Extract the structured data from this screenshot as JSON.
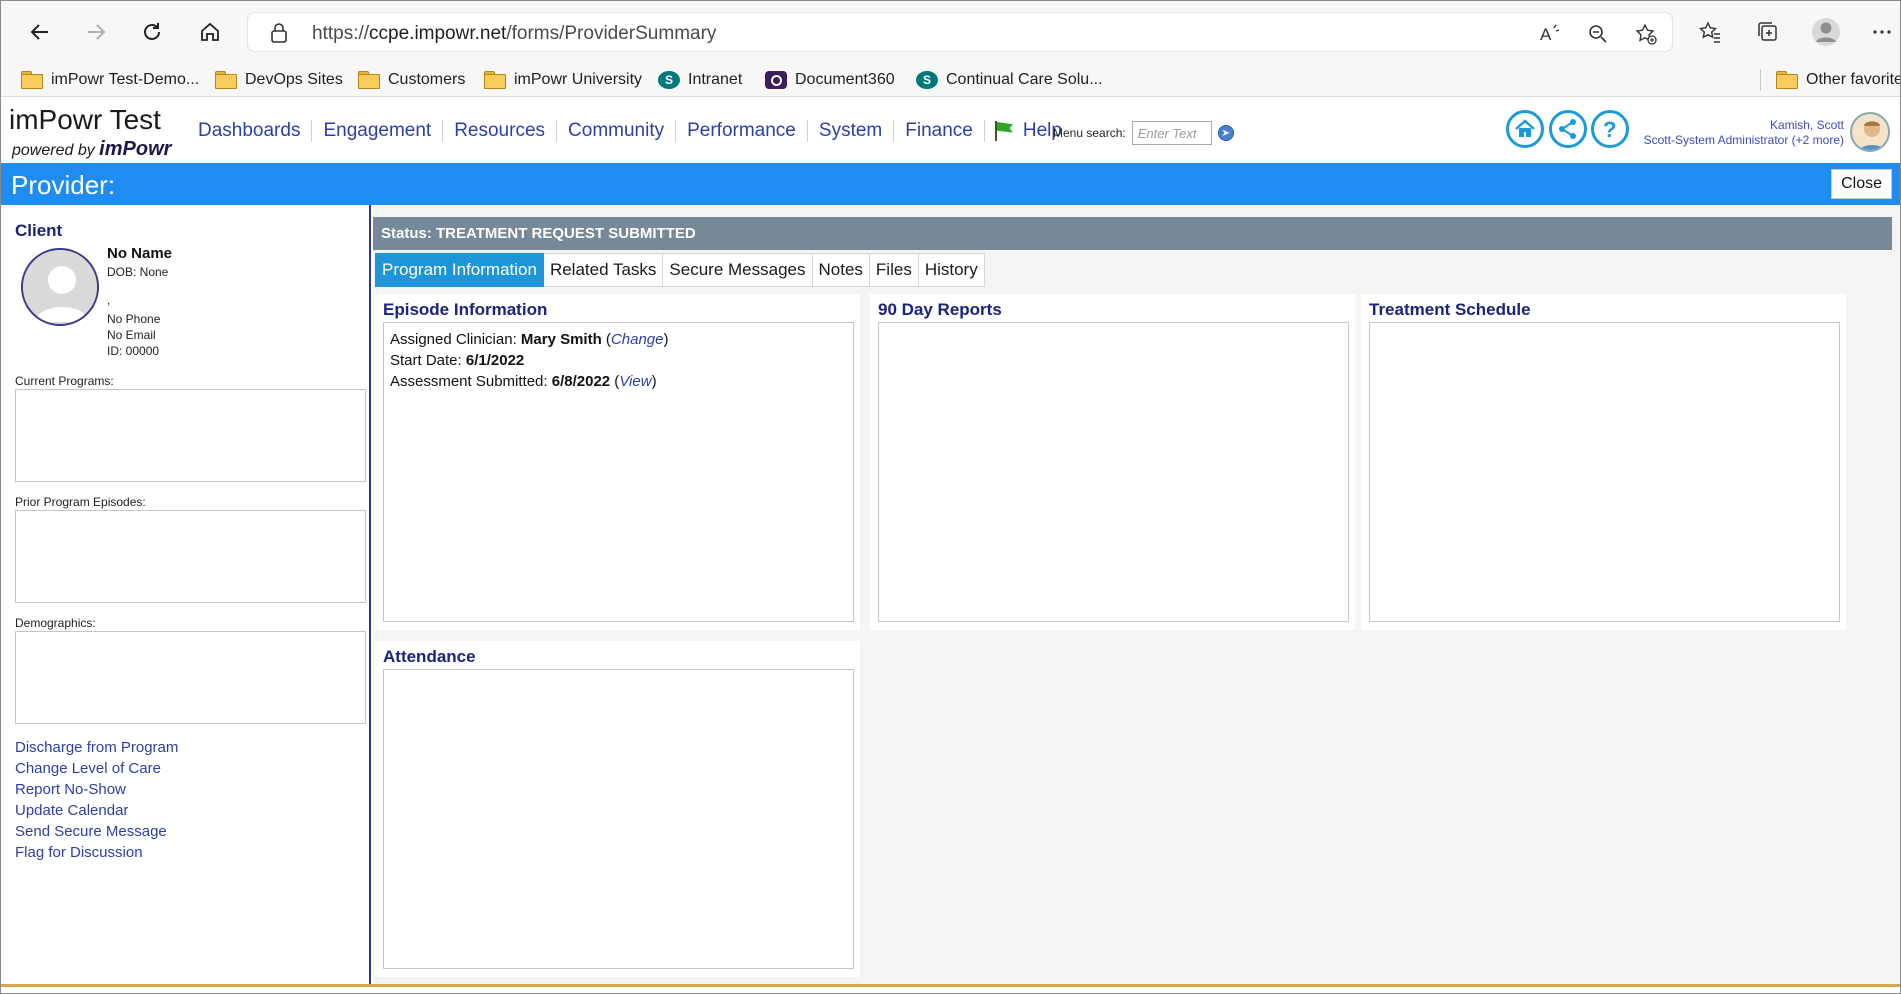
{
  "browser": {
    "url_prefix": "https://",
    "url_host": "ccpe.impowr.net",
    "url_path": "/forms/ProviderSummary",
    "bookmarks": [
      {
        "label": "imPowr Test-Demo...",
        "icon": "folder-icon"
      },
      {
        "label": "DevOps Sites",
        "icon": "folder-icon"
      },
      {
        "label": "Customers",
        "icon": "folder-icon"
      },
      {
        "label": "imPowr University",
        "icon": "folder-icon"
      },
      {
        "label": "Intranet",
        "icon": "sharepoint-icon"
      },
      {
        "label": "Document360",
        "icon": "document360-icon"
      },
      {
        "label": "Continual Care Solu...",
        "icon": "sharepoint-icon"
      }
    ],
    "other_favorites": "Other favorites"
  },
  "header": {
    "brand_title": "imPowr Test",
    "brand_sub_prefix": "powered by",
    "brand_sub_name": "imPowr",
    "nav": [
      "Dashboards",
      "Engagement",
      "Resources",
      "Community",
      "Performance",
      "System",
      "Finance"
    ],
    "help": "Help",
    "menu_search_label": "Menu search:",
    "menu_search_placeholder": "Enter Text",
    "user_name": "Kamish, Scott",
    "user_role": "Scott-System Administrator (+2 more)"
  },
  "provider_bar": {
    "title": "Provider:",
    "close_label": "Close"
  },
  "client": {
    "heading": "Client",
    "name": "No Name",
    "dob": "DOB: None",
    "comma": ",",
    "phone": "No Phone",
    "email": "No Email",
    "id": "ID: 00000",
    "current_programs_label": "Current Programs:",
    "prior_episodes_label": "Prior Program Episodes:",
    "demographics_label": "Demographics:",
    "actions": [
      "Discharge from Program",
      "Change Level of Care",
      "Report No-Show",
      "Update Calendar",
      "Send Secure Message",
      "Flag for Discussion"
    ]
  },
  "status": {
    "text": "Status: TREATMENT REQUEST SUBMITTED"
  },
  "tabs": [
    "Program Information",
    "Related Tasks",
    "Secure Messages",
    "Notes",
    "Files",
    "History"
  ],
  "episode": {
    "title": "Episode Information",
    "clinician_label": "Assigned Clinician:",
    "clinician_value": "Mary Smith",
    "change_link": "Change",
    "start_label": "Start Date:",
    "start_value": "6/1/2022",
    "assessment_label": "Assessment Submitted:",
    "assessment_value": "6/8/2022",
    "view_link": "View"
  },
  "cards": {
    "reports_title": "90 Day Reports",
    "schedule_title": "Treatment Schedule",
    "attendance_title": "Attendance"
  },
  "colors": {
    "accent_blue": "#1e8cf0",
    "tab_active": "#1e95d6",
    "status_bar": "#778899",
    "link": "#2b3fa8",
    "heading": "#1a237e"
  }
}
